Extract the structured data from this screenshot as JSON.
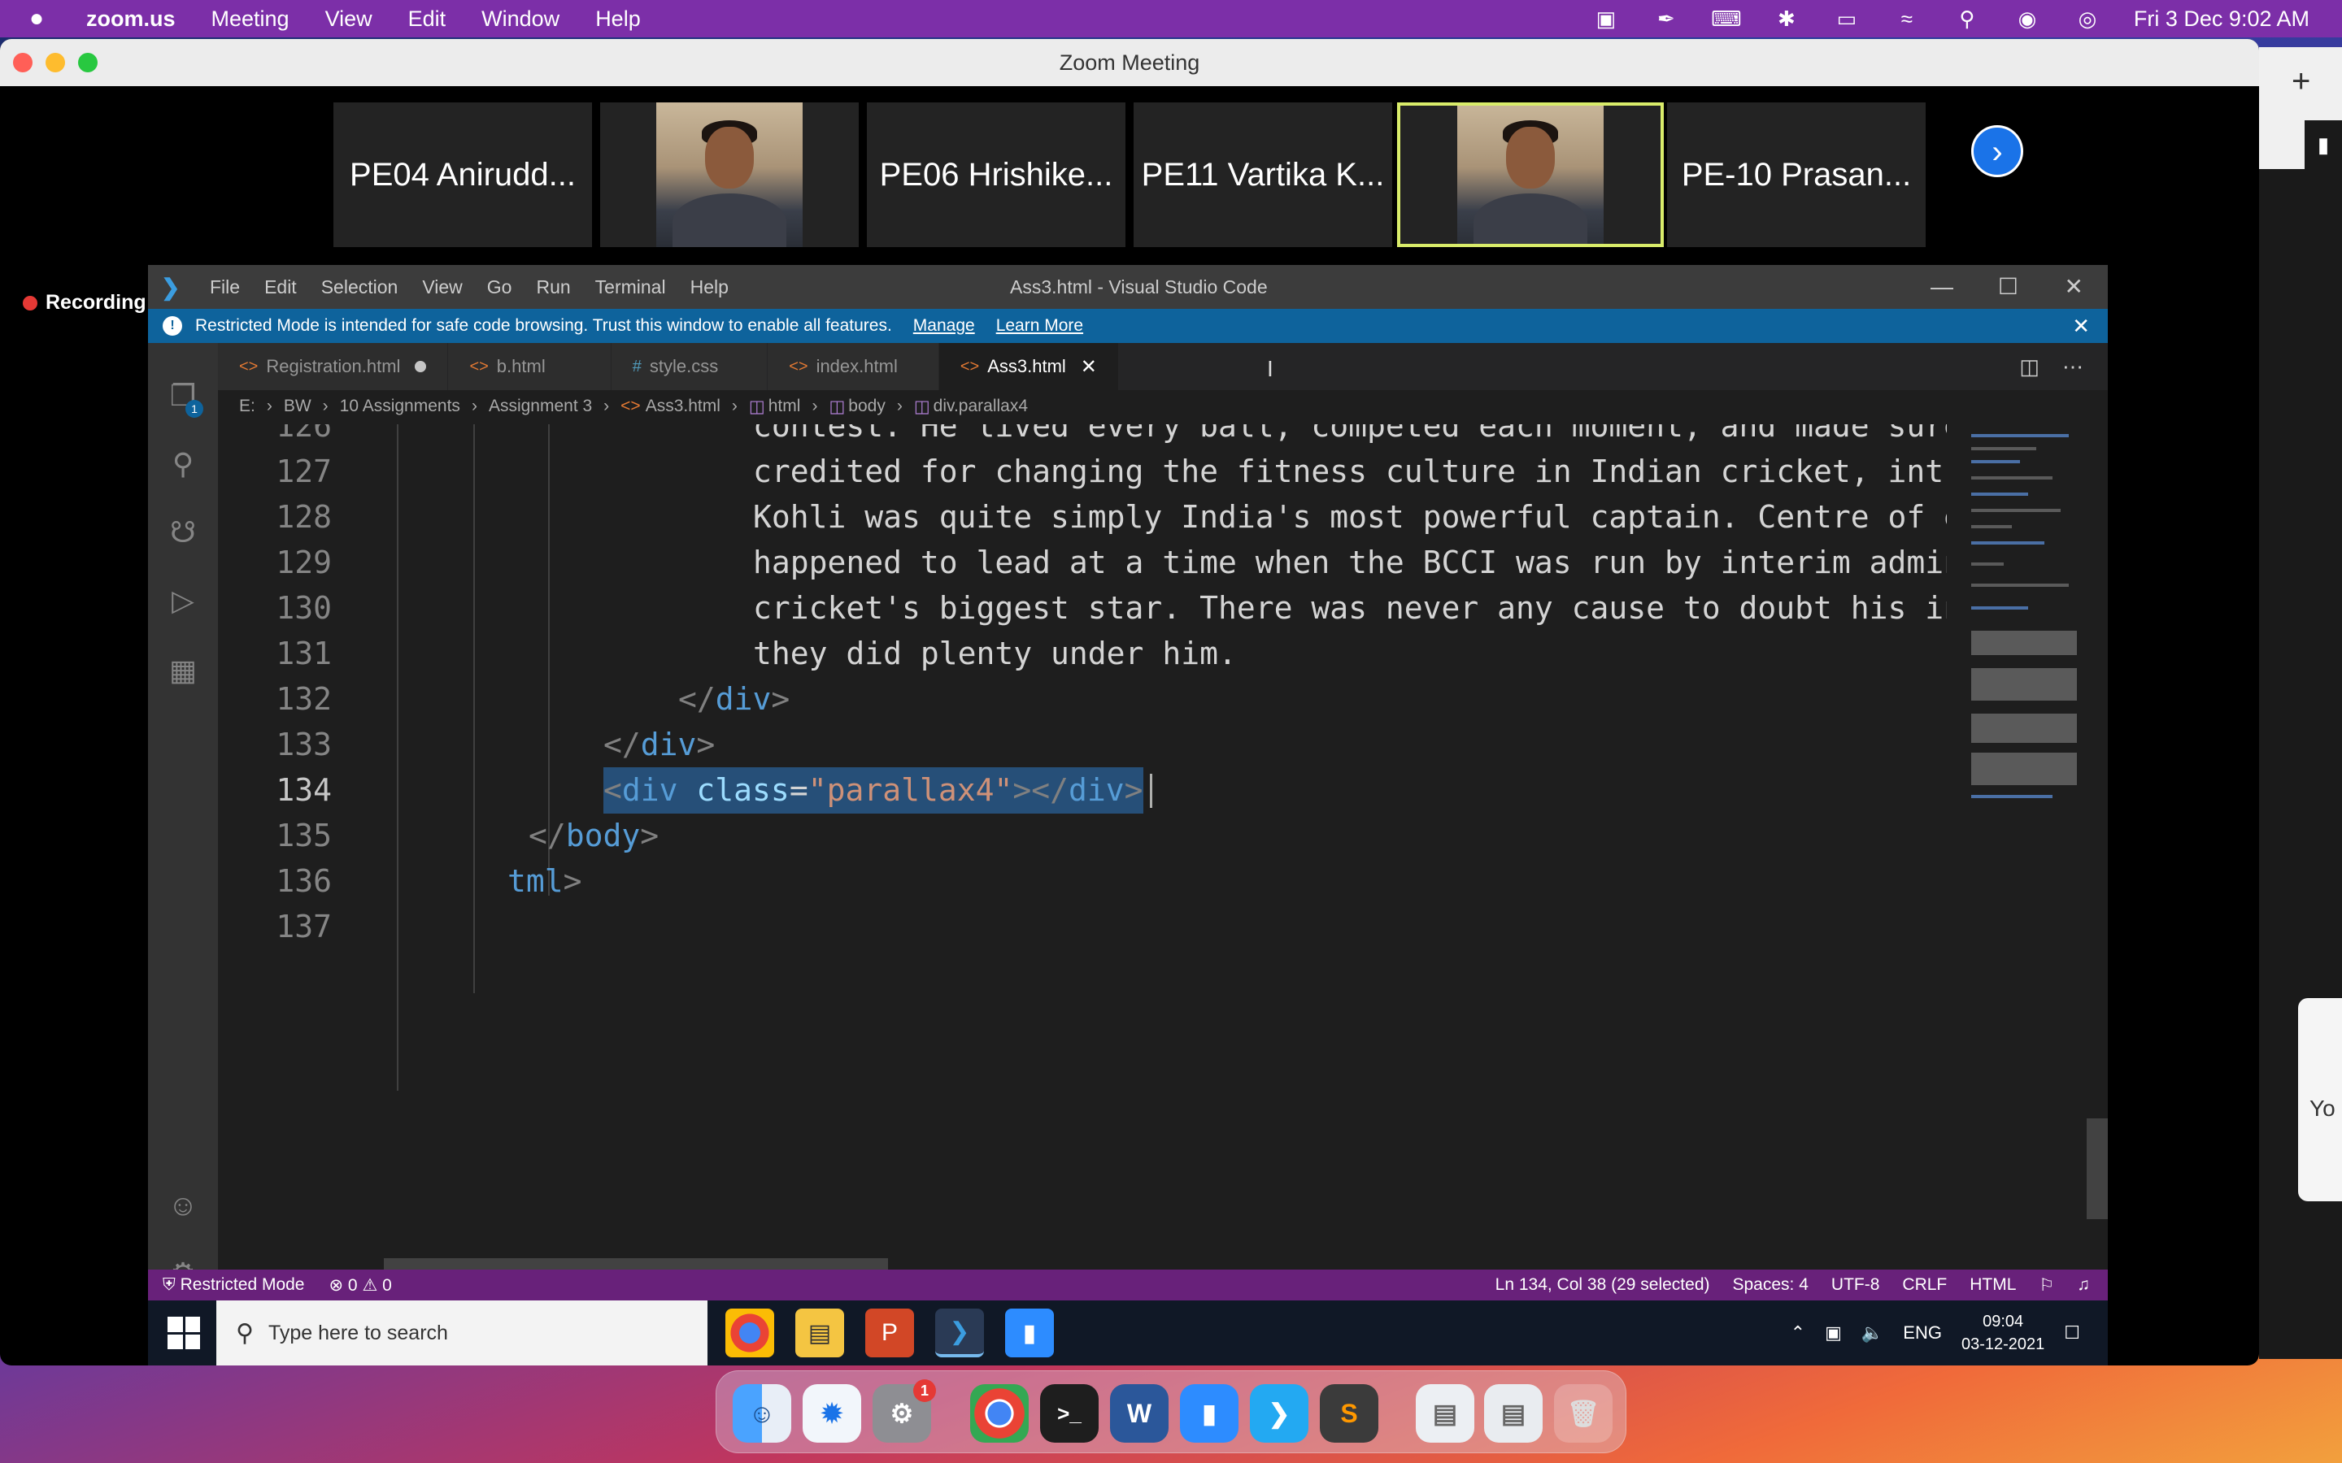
{
  "mac": {
    "app_name": "zoom.us",
    "menu": [
      "Meeting",
      "View",
      "Edit",
      "Window",
      "Help"
    ],
    "clock": "Fri 3 Dec  9:02 AM"
  },
  "zoom": {
    "window_title": "Zoom Meeting",
    "participants": [
      "PE04 Anirudd...",
      "",
      "PE06 Hrishike...",
      "PE11 Vartika K...",
      "",
      "PE-10 Prasan..."
    ],
    "recording_label": "Recording",
    "right_panel_text": "Yo"
  },
  "vscode": {
    "menu": [
      "File",
      "Edit",
      "Selection",
      "View",
      "Go",
      "Run",
      "Terminal",
      "Help"
    ],
    "window_title": "Ass3.html - Visual Studio Code",
    "banner": {
      "message": "Restricted Mode is intended for safe code browsing. Trust this window to enable all features.",
      "manage": "Manage",
      "learn_more": "Learn More"
    },
    "tabs": [
      {
        "icon": "<>",
        "label": "Registration.html"
      },
      {
        "icon": "<>",
        "label": "b.html"
      },
      {
        "icon": "#",
        "label": "style.css"
      },
      {
        "icon": "<>",
        "label": "index.html"
      },
      {
        "icon": "<>",
        "label": "Ass3.html"
      }
    ],
    "breadcrumb": [
      "E:",
      "BW",
      "10 Assignments",
      "Assignment 3",
      "Ass3.html",
      "html",
      "body",
      "div.parallax4"
    ],
    "explorer_badge": "1",
    "lines": {
      "n126": "126",
      "t126": "contest. He lived every ball, competed each moment, and made sure he had",
      "n127": "127",
      "t127": "credited for changing the fitness culture in Indian cricket, introducing",
      "n128": "128",
      "t128": "Kohli was quite simply India's most powerful captain. Centre of every ma",
      "n129": "129",
      "t129": "happened to lead at a time when the BCCI was run by interim administrato",
      "n130": "130",
      "t130": "cricket's biggest star. There was never any cause to doubt his intent: t",
      "n131": "131",
      "t131": "they did plenty under him.",
      "n132": "132",
      "n133": "133",
      "n134": "134",
      "n135": "135",
      "n136": "136",
      "n137": "137",
      "div": "div",
      "class_attr": "class",
      "class_val": "\"parallax4\"",
      "body": "body",
      "html_frag": "tml"
    },
    "status": {
      "mode": "Restricted Mode",
      "problems": "⊗ 0 ⚠ 0",
      "position": "Ln 134, Col 38 (29 selected)",
      "spaces": "Spaces: 4",
      "encoding": "UTF-8",
      "eol": "CRLF",
      "language": "HTML"
    }
  },
  "taskbar": {
    "search_placeholder": "Type here to search",
    "lang": "ENG",
    "time": "09:04",
    "date": "03-12-2021"
  },
  "dock": {
    "settings_badge": "1"
  }
}
